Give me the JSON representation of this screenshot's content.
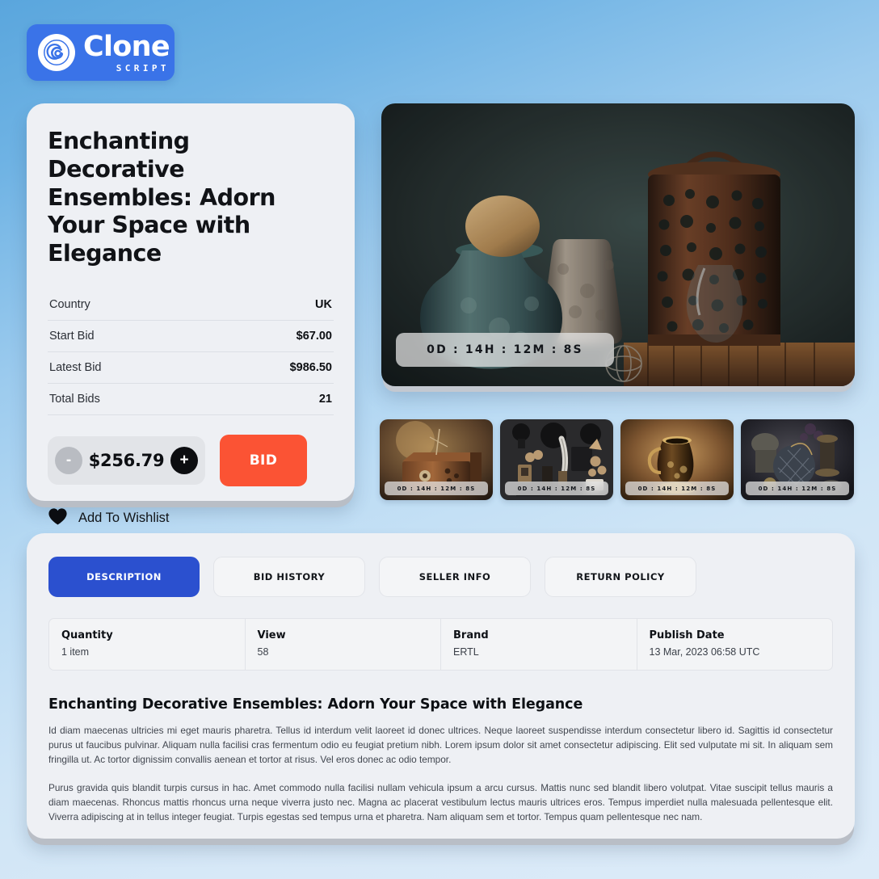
{
  "brand": {
    "name": "Clone",
    "tagline": "SCRIPT",
    "logo_icon": "clone-spiral-c-icon",
    "badge_color": "#3a73e8"
  },
  "product": {
    "title": "Enchanting Decorative Ensembles: Adorn Your Space with Elegance",
    "specs": [
      {
        "label": "Country",
        "value": "UK"
      },
      {
        "label": "Start Bid",
        "value": "$67.00"
      },
      {
        "label": "Latest Bid",
        "value": "$986.50"
      },
      {
        "label": "Total Bids",
        "value": "21"
      }
    ],
    "bid_control": {
      "decrement_label": "-",
      "increment_label": "+",
      "amount": "$256.79",
      "bid_button_label": "BID",
      "bid_button_color": "#fb5334"
    },
    "wishlist": {
      "icon": "heart-icon",
      "label": "Add To Wishlist"
    }
  },
  "auction_timer": "0D : 14H : 12M : 8S",
  "gallery": {
    "hero_alt": "antique ceramic vessels and rusted lattice lantern still life",
    "thumbnails": [
      {
        "alt": "ornate wooden music box",
        "timer": "0D : 14H : 12M : 8S"
      },
      {
        "alt": "collection of dark antique curios on board",
        "timer": "0D : 14H : 12M : 8S"
      },
      {
        "alt": "golden engraved ceramic pitcher",
        "timer": "0D : 14H : 12M : 8S"
      },
      {
        "alt": "quilted vintage handbag with brass objects",
        "timer": "0D : 14H : 12M : 8S"
      }
    ]
  },
  "tabs": [
    {
      "label": "DESCRIPTION",
      "active": true
    },
    {
      "label": "BID HISTORY",
      "active": false
    },
    {
      "label": "SELLER INFO",
      "active": false
    },
    {
      "label": "RETURN POLICY",
      "active": false
    }
  ],
  "tab_accent_color": "#2b50cf",
  "info_table": [
    {
      "head": "Quantity",
      "value": "1 item"
    },
    {
      "head": "View",
      "value": "58"
    },
    {
      "head": "Brand",
      "value": "ERTL"
    },
    {
      "head": "Publish Date",
      "value": "13 Mar, 2023 06:58 UTC"
    }
  ],
  "description": {
    "heading": "Enchanting Decorative Ensembles: Adorn Your Space with Elegance",
    "paragraph_1": "Id diam maecenas ultricies mi eget mauris pharetra. Tellus id interdum velit laoreet id donec ultrices. Neque laoreet suspendisse interdum consectetur libero id. Sagittis id consectetur purus ut faucibus pulvinar. Aliquam nulla facilisi cras fermentum odio eu feugiat pretium nibh. Lorem ipsum dolor sit amet consectetur adipiscing. Elit sed vulputate mi sit. In aliquam sem fringilla ut. Ac tortor dignissim convallis aenean et tortor at risus. Vel eros donec ac odio tempor.",
    "paragraph_2": "Purus gravida quis blandit turpis cursus in hac. Amet commodo nulla facilisi nullam vehicula ipsum a arcu cursus. Mattis nunc sed blandit libero volutpat. Vitae suscipit tellus mauris a diam maecenas. Rhoncus mattis rhoncus urna neque viverra justo nec. Magna ac placerat vestibulum lectus mauris ultrices eros. Tempus imperdiet nulla malesuada pellentesque elit. Viverra adipiscing at in tellus integer feugiat. Turpis egestas sed tempus urna et pharetra. Nam aliquam sem et tortor. Tempus quam pellentesque nec nam."
  }
}
